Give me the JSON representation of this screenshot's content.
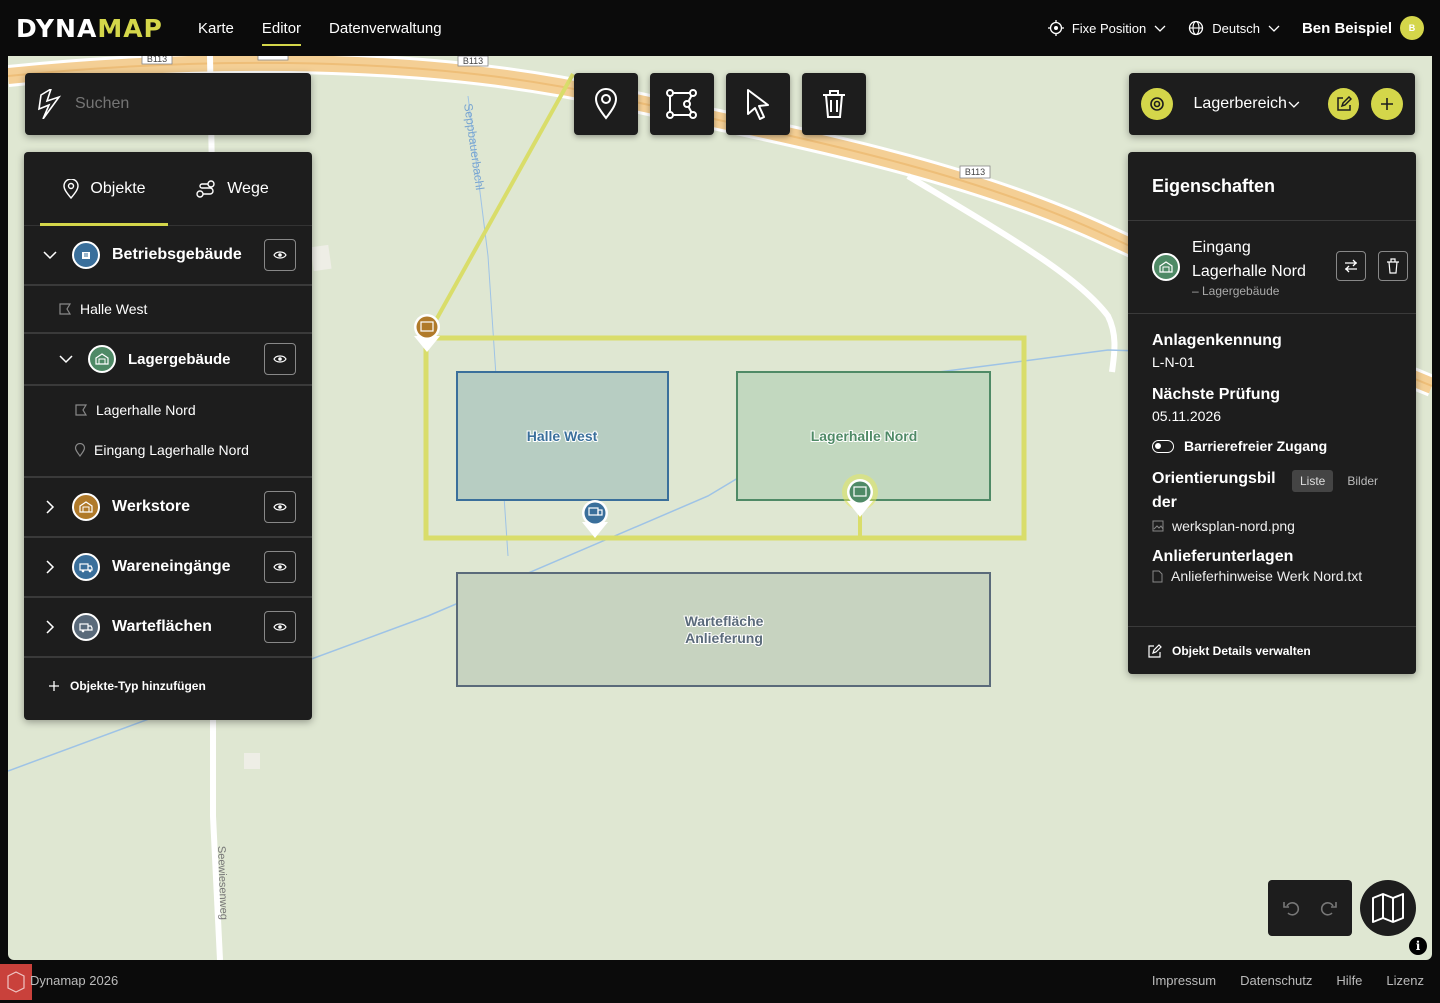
{
  "brand": {
    "part1": "DYNA",
    "part2": "MAP"
  },
  "nav": {
    "items": [
      "Karte",
      "Editor",
      "Datenverwaltung"
    ],
    "active": "Editor"
  },
  "topbar": {
    "position_label": "Fixe Position",
    "language": "Deutsch",
    "user_name": "Ben Beispiel",
    "avatar_initial": "B"
  },
  "search": {
    "placeholder": "Suchen"
  },
  "left_panel": {
    "tabs": [
      {
        "label": "Objekte",
        "icon": "map-pin-icon"
      },
      {
        "label": "Wege",
        "icon": "route-icon"
      }
    ],
    "groups": {
      "betrieb": {
        "label": "Betriebsgebäude",
        "color": "#3a6f9b",
        "children": [
          "Halle West"
        ]
      },
      "lager": {
        "label": "Lagergebäude",
        "color": "#4f8a66",
        "children": [
          "Lagerhalle Nord",
          "Eingang Lagerhalle Nord"
        ]
      },
      "werkstore": {
        "label": "Werkstore",
        "color": "#b07a2a"
      },
      "wareneingaenge": {
        "label": "Wareneingänge",
        "color": "#3a6f9b"
      },
      "warteflaechen": {
        "label": "Warteflächen",
        "color": "#5a6a7a"
      }
    },
    "add_label": "Objekte-Typ hinzufügen"
  },
  "toolbar": {
    "tools": [
      "marker-tool",
      "polygon-tool",
      "select-tool",
      "delete-tool"
    ]
  },
  "area_bar": {
    "label": "Lagerbereich"
  },
  "properties": {
    "header": "Eigenschaften",
    "object": {
      "name_line1": "Eingang",
      "name_line2": "Lagerhalle Nord",
      "type": "– Lagergebäude"
    },
    "fields": {
      "kennung_label": "Anlagenkennung",
      "kennung_value": "L-N-01",
      "pruefung_label": "Nächste Prüfung",
      "pruefung_value": "05.11.2026",
      "toggle_label": "Barrierefreier Zugang",
      "orient_label_1": "Orientierungsbil",
      "orient_label_2": "der",
      "view_list": "Liste",
      "view_images": "Bilder",
      "orient_file": "werksplan-nord.png",
      "anlief_label": "Anlieferunterlagen",
      "anlief_file": "Anlieferhinweise Werk Nord.txt"
    },
    "details_label": "Objekt Details verwalten"
  },
  "map": {
    "labels": {
      "halle_west": "Halle West",
      "lagerhalle_nord": "Lagerhalle Nord",
      "warte_1": "Wartefläche",
      "warte_2": "Anlieferung"
    },
    "road_labels": [
      "B113",
      "B113",
      "B113",
      "B113"
    ],
    "street_names": [
      "Seppbauerbachl",
      "Seewiesenweg"
    ]
  },
  "footer": {
    "copyright": "Dynamap 2026",
    "links": [
      "Impressum",
      "Datenschutz",
      "Hilfe",
      "Lizenz"
    ]
  }
}
